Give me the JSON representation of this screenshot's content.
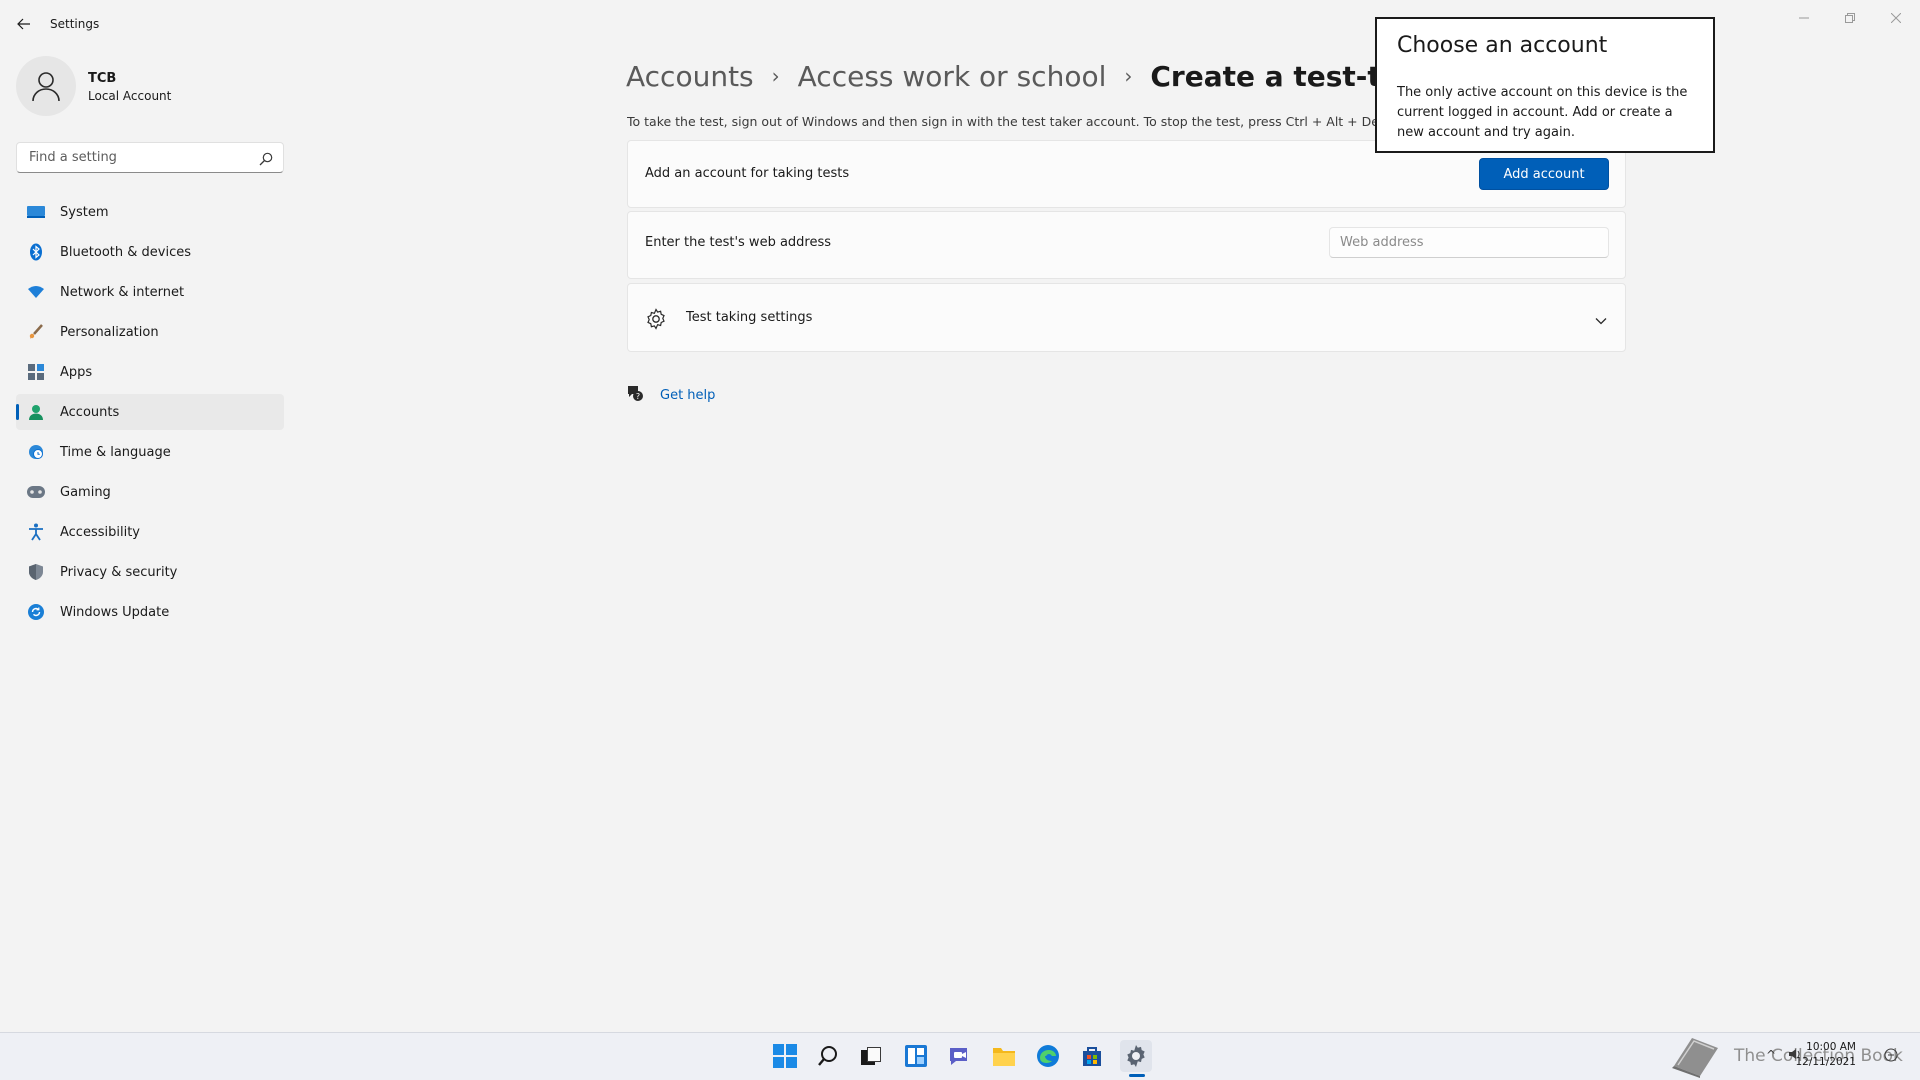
{
  "window": {
    "title": "Settings"
  },
  "profile": {
    "name": "TCB",
    "subtitle": "Local Account"
  },
  "search": {
    "placeholder": "Find a setting"
  },
  "sidebar": {
    "items": [
      {
        "label": "System",
        "icon": "system-icon"
      },
      {
        "label": "Bluetooth & devices",
        "icon": "bluetooth-icon"
      },
      {
        "label": "Network & internet",
        "icon": "wifi-icon"
      },
      {
        "label": "Personalization",
        "icon": "brush-icon"
      },
      {
        "label": "Apps",
        "icon": "apps-icon"
      },
      {
        "label": "Accounts",
        "icon": "person-icon",
        "active": true
      },
      {
        "label": "Time & language",
        "icon": "globe-clock-icon"
      },
      {
        "label": "Gaming",
        "icon": "gamepad-icon"
      },
      {
        "label": "Accessibility",
        "icon": "accessibility-icon"
      },
      {
        "label": "Privacy & security",
        "icon": "shield-icon"
      },
      {
        "label": "Windows Update",
        "icon": "update-icon"
      }
    ]
  },
  "breadcrumb": {
    "items": [
      "Accounts",
      "Access work or school",
      "Create a test-taking a"
    ]
  },
  "main": {
    "info_text": "To take the test, sign out of Windows and then sign in with the test taker account. To stop the test, press Ctrl + Alt + Dele",
    "add_account_card": {
      "label": "Add an account for taking tests",
      "button_label": "Add account"
    },
    "web_address_card": {
      "label": "Enter the test's web address",
      "placeholder": "Web address",
      "value": ""
    },
    "settings_card": {
      "label": "Test taking settings"
    },
    "help_label": "Get help"
  },
  "dialog": {
    "title": "Choose an account",
    "body": "The only active account on this device is the current logged in account. Add or create a new account and try again."
  },
  "taskbar": {
    "icons": [
      "windows-start-icon",
      "search-icon",
      "task-view-icon",
      "widgets-icon",
      "chat-icon",
      "file-explorer-icon",
      "edge-icon",
      "store-icon",
      "settings-gear-icon"
    ],
    "watermark_text": "The Collection Book",
    "time": "10:00 AM",
    "date": "12/11/2021"
  },
  "colors": {
    "accent": "#005fb8",
    "background": "#f3f3f3",
    "card": "#fbfbfb"
  }
}
